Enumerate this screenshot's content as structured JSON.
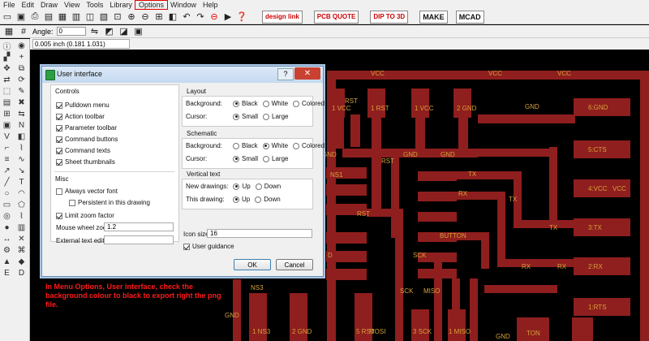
{
  "menu": [
    "File",
    "Edit",
    "Draw",
    "View",
    "Tools",
    "Library",
    "Options",
    "Window",
    "Help"
  ],
  "toolbar": {
    "ext_buttons": [
      "design link",
      "PCB QUOTE",
      "DIP TO 3D",
      "MAKE",
      "MCAD"
    ]
  },
  "param_toolbar": {
    "angle_label": "Angle:",
    "angle_value": "0"
  },
  "coords": "0.005 inch (0.181 1.031)",
  "dialog": {
    "title": "User interface",
    "help": "?",
    "close": "✕",
    "controls": {
      "heading": "Controls",
      "items": [
        "Pulldown menu",
        "Action toolbar",
        "Parameter toolbar",
        "Command buttons",
        "Command texts",
        "Sheet thumbnails"
      ]
    },
    "misc": {
      "heading": "Misc",
      "always_vector_font": "Always vector font",
      "persistent": "Persistent in this drawing",
      "limit_zoom": "Limit zoom factor",
      "mouse_wheel_label": "Mouse wheel zoom",
      "mouse_wheel_value": "1.2",
      "ext_editor_label": "External text editor",
      "ext_editor_value": ""
    },
    "layout": {
      "heading": "Layout",
      "background_label": "Background:",
      "cursor_label": "Cursor:",
      "bg_options": [
        "Black",
        "White",
        "Colored"
      ],
      "cursor_options": [
        "Small",
        "Large"
      ]
    },
    "schematic": {
      "heading": "Schematic",
      "background_label": "Background:",
      "cursor_label": "Cursor:",
      "bg_options": [
        "Black",
        "White",
        "Colored"
      ],
      "cursor_options": [
        "Small",
        "Large"
      ]
    },
    "vertical_text": {
      "heading": "Vertical text",
      "new_label": "New drawings:",
      "this_label": "This drawing:",
      "options": [
        "Up",
        "Down"
      ]
    },
    "icon_size_label": "Icon size",
    "icon_size_value": "16",
    "user_guidance": "User guidance",
    "ok": "OK",
    "cancel": "Cancel"
  },
  "annotation": "In Menu Options, User interface, check the background colour to black to export right the png file.",
  "pcb": {
    "labels": [
      "VCC",
      "VCC",
      "VCC",
      "VCC",
      "GND",
      "GND",
      "GND",
      "GND",
      "TX",
      "TX",
      "TX",
      "RX",
      "RX",
      "RX",
      "RST",
      "RST",
      "RST",
      "BUTTON",
      "SCK",
      "SCK",
      "MISO",
      "MOSI",
      "NS1",
      "NS3",
      "D",
      "6:GND",
      "5:CTS",
      "4:VCC",
      "3:TX",
      "2:RX",
      "1:RTS",
      "1 VCC",
      "1 RST",
      "1 VCC",
      "2 GND",
      "1 NS3",
      "2 GND",
      "5 RST",
      "3 SCK",
      "1 MISO",
      "GND",
      "GND",
      "TON"
    ]
  },
  "colors": {
    "trace": "#8f1e1e",
    "label": "#d4a23a",
    "board": "#000000",
    "highlight": "#e00000"
  }
}
